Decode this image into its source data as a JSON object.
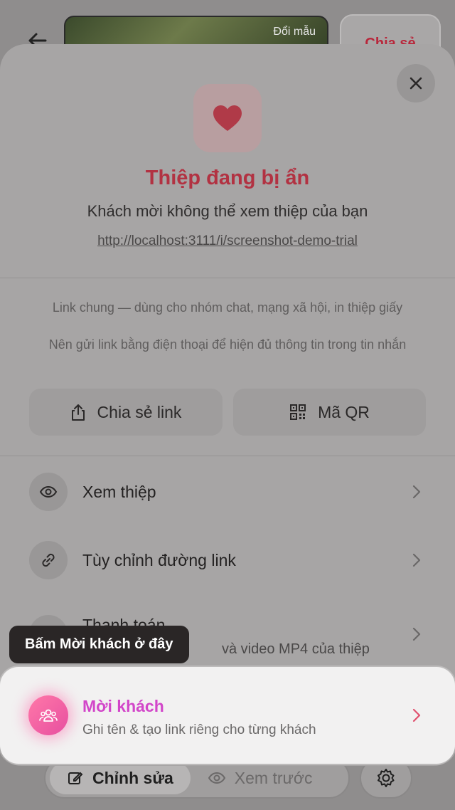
{
  "background": {
    "thumbnail_label": "Đổi mẫu",
    "share_button_label": "Chia sẻ",
    "toolbar": {
      "edit_label": "Chỉnh sửa",
      "preview_label": "Xem trước"
    }
  },
  "sheet": {
    "title": "Thiệp đang bị ẩn",
    "subtitle": "Khách mời không thể xem thiệp của bạn",
    "url": "http://localhost:3111/i/screenshot-demo-trial",
    "info_line_1": "Link chung — dùng cho nhóm chat, mạng xã hội, in thiệp giấy",
    "info_line_2": "Nên gửi link bằng điện thoại để hiện đủ thông tin trong tin nhắn",
    "share_link_label": "Chia sẻ link",
    "qr_label": "Mã QR",
    "rows": [
      {
        "label": "Xem thiệp",
        "icon": "eye-icon"
      },
      {
        "label": "Tùy chỉnh đường link",
        "icon": "link-icon"
      },
      {
        "label": "Thanh toán",
        "sub": "và video MP4 của thiệp",
        "icon": "payment-icon"
      }
    ],
    "highlight": {
      "title": "Mời khách",
      "subtitle": "Ghi tên & tạo link riêng cho từng khách"
    }
  },
  "tooltip": {
    "text": "Bấm Mời khách ở đây"
  },
  "colors": {
    "accent_red": "#b23242",
    "accent_pink": "#e74fa0",
    "highlight_title": "#d246c9"
  }
}
